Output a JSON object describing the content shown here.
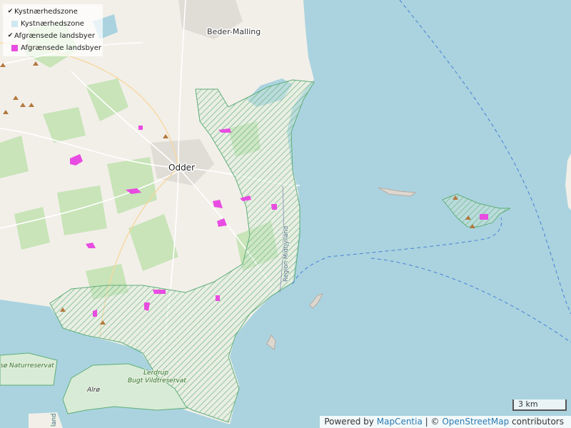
{
  "legend": {
    "items": [
      {
        "label": "Kystnærhedszone",
        "checked": true
      },
      {
        "label": "Kystnærhedszone",
        "swatch_color": "#cfe7f0"
      },
      {
        "label": "Afgrænsede landsbyer",
        "checked": true
      },
      {
        "label": "Afgrænsede landsbyer",
        "swatch_color": "#e84ce0"
      }
    ]
  },
  "places": {
    "beder_malling": "Beder-Malling",
    "odder": "Odder",
    "alro": "Alrø"
  },
  "reserves": {
    "naturreservat": "sø Naturreservat",
    "lerdrup_1": "Lerdrup",
    "lerdrup_2": "Bugt Vildtreservat"
  },
  "region_label": "Region Midtjylland",
  "partial_label": "land",
  "scale_label": "3 km",
  "attribution": {
    "powered_by": "Powered by",
    "provider": "MapCentia",
    "separator": "| ©",
    "osm": "OpenStreetMap",
    "contributors": "contributors"
  },
  "colors": {
    "water": "#aad3df",
    "land": "#f2efe9",
    "coastal_zone_hatch": "#62b07c",
    "villages": "#e84ce0",
    "forest": "#c8e4b8"
  }
}
